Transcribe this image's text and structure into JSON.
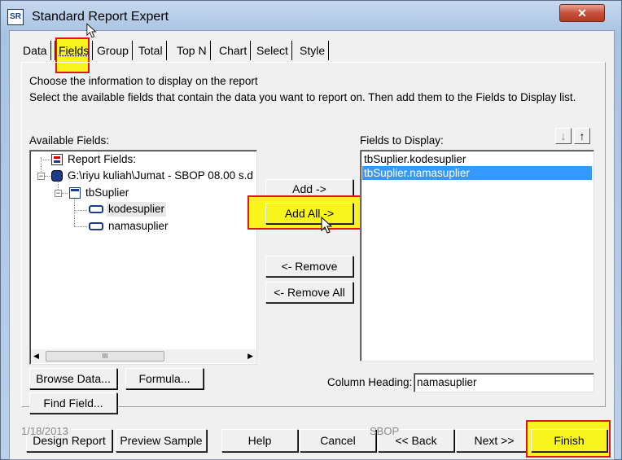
{
  "window": {
    "title": "Standard Report Expert",
    "app_icon_text": "SR",
    "close_glyph": "✕"
  },
  "tabs": [
    "Data",
    "Fields",
    "Group",
    "Total",
    "Top N",
    "Chart",
    "Select",
    "Style"
  ],
  "active_tab": "Fields",
  "instructions": {
    "line1": "Choose the information to display on the report",
    "line2": "Select the available fields that contain the data you want to report on.  Then add them to the Fields to Display list."
  },
  "available_fields": {
    "label": "Available Fields:",
    "tree": {
      "report_fields": "Report Fields:",
      "database": "G:\\riyu kuliah\\Jumat - SBOP 08.00 s.d",
      "table": "tbSuplier",
      "fields": [
        "kodesuplier",
        "namasuplier"
      ]
    },
    "scroll_thumb_glyph": "III"
  },
  "fields_to_display": {
    "label": "Fields to Display:",
    "items": [
      "tbSuplier.kodesuplier",
      "tbSuplier.namasuplier"
    ],
    "selected_index": 1,
    "move_down_glyph": "↓",
    "move_up_glyph": "↑"
  },
  "buttons": {
    "add": "Add ->",
    "add_all": "Add All ->",
    "remove": "<- Remove",
    "remove_all": "<- Remove All",
    "browse_data": "Browse Data...",
    "formula": "Formula...",
    "find_field": "Find Field...",
    "design_report": "Design Report",
    "preview_sample": "Preview Sample",
    "help": "Help",
    "cancel": "Cancel",
    "back": "<< Back",
    "next": "Next >>",
    "finish": "Finish"
  },
  "column_heading": {
    "label": "Column Heading:",
    "value": "namasuplier"
  },
  "overlay_text": {
    "date": "1/18/2013",
    "course": "SBOP"
  },
  "colors": {
    "highlight_fill": "#f8f41c",
    "highlight_border": "#e0141c",
    "selection": "#3399ff"
  }
}
